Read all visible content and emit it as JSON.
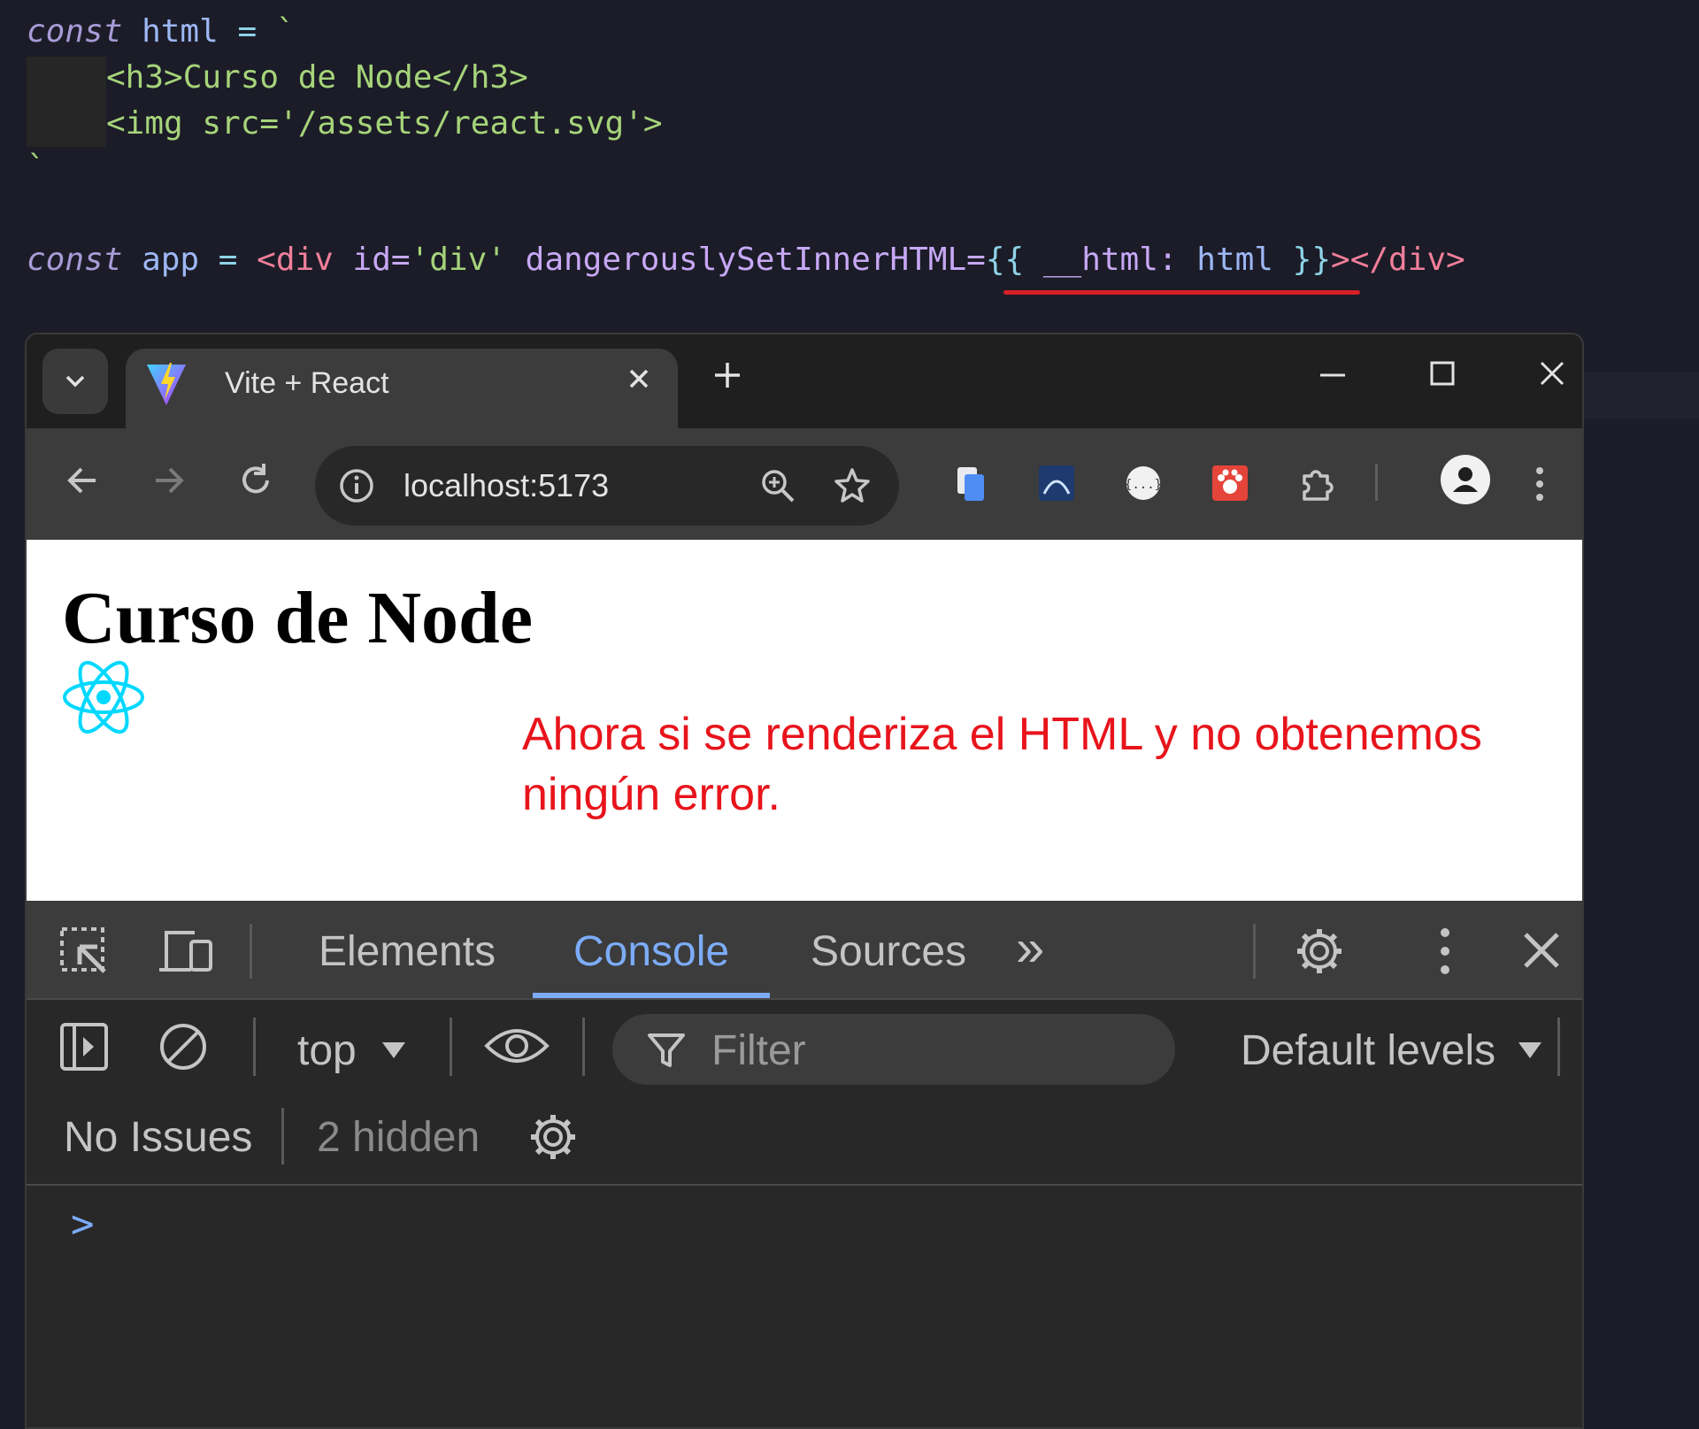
{
  "code": {
    "line1": {
      "kw": "const",
      "name": "html",
      "op": "=",
      "tick": "`"
    },
    "line2": "<h3>Curso de Node</h3>",
    "line3": "<img src='/assets/react.svg'>",
    "line4": "`",
    "line5": {
      "kw": "const",
      "name": "app",
      "op": "=",
      "open": "<div",
      "attr1": "id=",
      "val1": "'div'",
      "attr2": "dangerouslySetInnerHTML=",
      "brace_open": "{{",
      "key": "__html:",
      "value": "html",
      "brace_close": "}}",
      "close": "></div>"
    }
  },
  "browser": {
    "tab_title": "Vite + React",
    "url": "localhost:5173",
    "icons": {
      "tab_list": "chevron-down-icon",
      "close_tab": "close-icon",
      "new_tab": "plus-icon",
      "minimize": "minimize-icon",
      "maximize": "maximize-icon",
      "close_window": "close-icon",
      "back": "back-arrow-icon",
      "forward": "forward-arrow-icon",
      "reload": "reload-icon",
      "site_info": "info-icon",
      "zoom": "zoom-icon",
      "bookmark": "star-icon",
      "profile": "profile-icon",
      "menu": "kebab-menu-icon"
    }
  },
  "page": {
    "heading": "Curso de Node",
    "annotation": "Ahora si se renderiza el HTML y no obtenemos ningún error."
  },
  "devtools": {
    "tabs": [
      "Elements",
      "Console",
      "Sources"
    ],
    "active_tab": "Console",
    "more": "»",
    "context": "top",
    "filter_placeholder": "Filter",
    "levels": "Default levels",
    "issues": "No Issues",
    "hidden": "2 hidden",
    "prompt": ">"
  },
  "colors": {
    "annotation": "#e8141c",
    "accent": "#7cacf8"
  }
}
